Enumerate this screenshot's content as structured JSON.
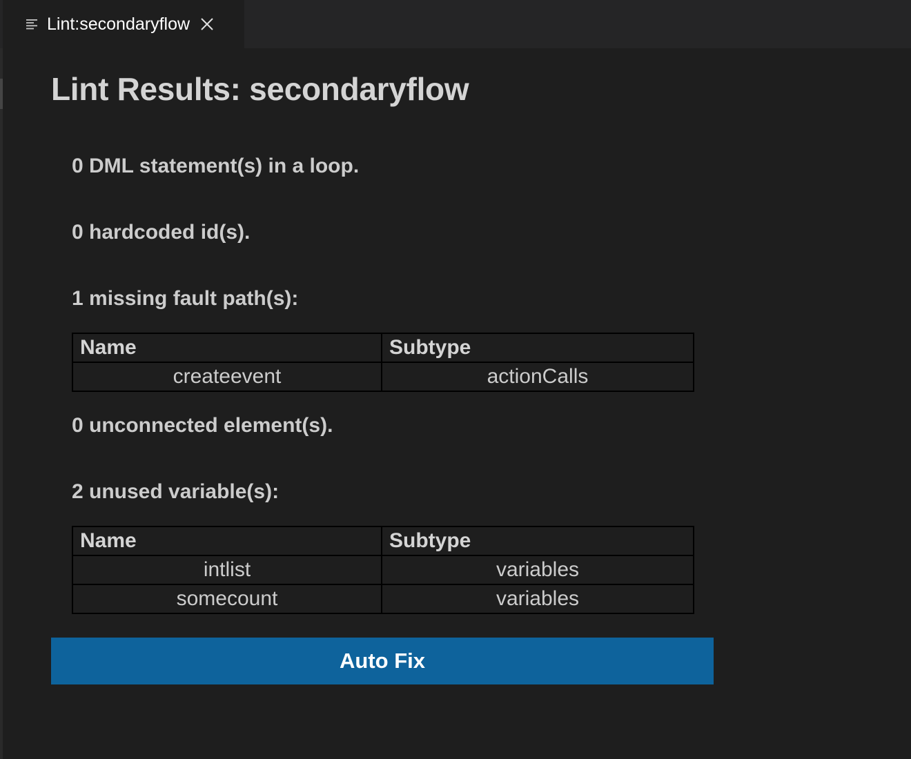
{
  "tab": {
    "title": "Lint:secondaryflow",
    "icon": "preview-lines-icon",
    "close_icon": "close-icon"
  },
  "page": {
    "title": "Lint Results: secondaryflow"
  },
  "sections": {
    "dml": {
      "heading": "0 DML statement(s) in a loop."
    },
    "hardcoded": {
      "heading": "0 hardcoded id(s)."
    },
    "fault": {
      "heading": "1 missing fault path(s):",
      "columns": [
        "Name",
        "Subtype"
      ],
      "rows": [
        {
          "name": "createevent",
          "subtype": "actionCalls"
        }
      ]
    },
    "unconnected": {
      "heading": "0 unconnected element(s)."
    },
    "unused": {
      "heading": "2 unused variable(s):",
      "columns": [
        "Name",
        "Subtype"
      ],
      "rows": [
        {
          "name": "intlist",
          "subtype": "variables"
        },
        {
          "name": "somecount",
          "subtype": "variables"
        }
      ]
    }
  },
  "actions": {
    "autofix_label": "Auto Fix"
  },
  "colors": {
    "background": "#1e1e1e",
    "tabbar": "#252526",
    "button": "#0e639c",
    "table_border": "#000000"
  }
}
